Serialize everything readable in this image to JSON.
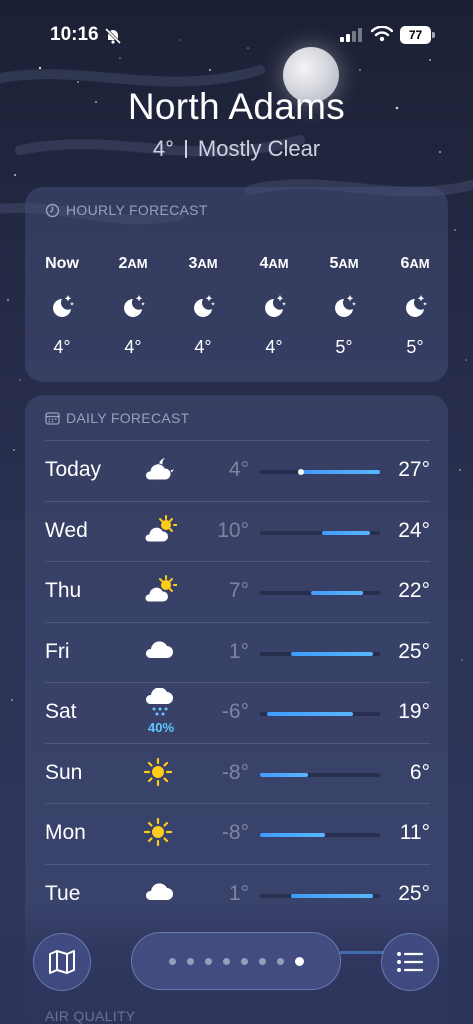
{
  "status_bar": {
    "time": "10:16",
    "battery": "77"
  },
  "location": {
    "city": "North Adams",
    "temperature": "4°",
    "condition": "Mostly Clear"
  },
  "hourly": {
    "title": "HOURLY FORECAST",
    "items": [
      {
        "time": "Now",
        "icon": "moon-stars-icon",
        "temp": "4°"
      },
      {
        "time": "2",
        "suffix": "AM",
        "icon": "moon-stars-icon",
        "temp": "4°"
      },
      {
        "time": "3",
        "suffix": "AM",
        "icon": "moon-stars-icon",
        "temp": "4°"
      },
      {
        "time": "4",
        "suffix": "AM",
        "icon": "moon-stars-icon",
        "temp": "4°"
      },
      {
        "time": "5",
        "suffix": "AM",
        "icon": "moon-stars-icon",
        "temp": "5°"
      },
      {
        "time": "6",
        "suffix": "AM",
        "icon": "moon-stars-icon",
        "temp": "5°"
      }
    ]
  },
  "daily": {
    "title": "DAILY FORECAST",
    "range_min": -8,
    "range_max": 27,
    "current_temp": 4,
    "days": [
      {
        "day": "Today",
        "icon": "cloud-moon-icon",
        "low": "4°",
        "high": "27°",
        "low_v": 4,
        "high_v": 27,
        "current": true
      },
      {
        "day": "Wed",
        "icon": "cloud-sun-icon",
        "low": "10°",
        "high": "24°",
        "low_v": 10,
        "high_v": 24
      },
      {
        "day": "Thu",
        "icon": "cloud-sun-icon",
        "low": "7°",
        "high": "22°",
        "low_v": 7,
        "high_v": 22
      },
      {
        "day": "Fri",
        "icon": "cloud-icon",
        "low": "1°",
        "high": "25°",
        "low_v": 1,
        "high_v": 25
      },
      {
        "day": "Sat",
        "icon": "cloud-snow-icon",
        "precip": "40%",
        "low": "-6°",
        "high": "19°",
        "low_v": -6,
        "high_v": 19
      },
      {
        "day": "Sun",
        "icon": "sun-icon",
        "low": "-8°",
        "high": "6°",
        "low_v": -8,
        "high_v": 6
      },
      {
        "day": "Mon",
        "icon": "sun-icon",
        "low": "-8°",
        "high": "11°",
        "low_v": -8,
        "high_v": 11
      },
      {
        "day": "Tue",
        "icon": "cloud-icon",
        "low": "1°",
        "high": "25°",
        "low_v": 1,
        "high_v": 25
      }
    ]
  },
  "next_section": {
    "title": "AIR QUALITY"
  },
  "bottom_bar": {
    "page_count": 8,
    "active_page": 8
  },
  "colors": {
    "accent": "#3f9cff",
    "precip": "#5fc8ff",
    "sun": "#ffcc1a"
  }
}
